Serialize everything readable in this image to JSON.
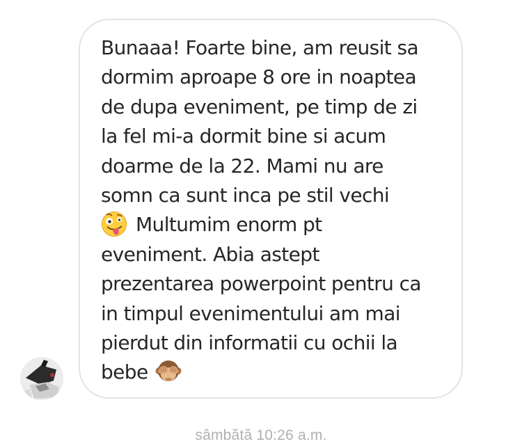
{
  "message": {
    "lines": [
      "Bunaaa! Foarte bine, am reusit sa",
      "dormim aproape 8 ore in noaptea",
      "de dupa eveniment, pe timp de zi",
      "la fel mi-a dormit bine si acum",
      "doarme de la 22. Mami nu are",
      "somn ca sunt inca pe stil vechi",
      "Multumim enorm pt",
      "eveniment. Abia astept",
      "prezentarea powerpoint pentru ca",
      "in timpul evenimentului am mai",
      "pierdut din informatii cu ochii la",
      "bebe"
    ],
    "emoji_1": "zany-face-emoji",
    "emoji_2": "see-no-evil-monkey-emoji"
  },
  "timestamp": "sâmbătă 10:26 a.m.",
  "colors": {
    "text": "#262626",
    "bubble_border": "#e3e3e3",
    "timestamp": "#b0b0b0",
    "background": "#ffffff"
  }
}
